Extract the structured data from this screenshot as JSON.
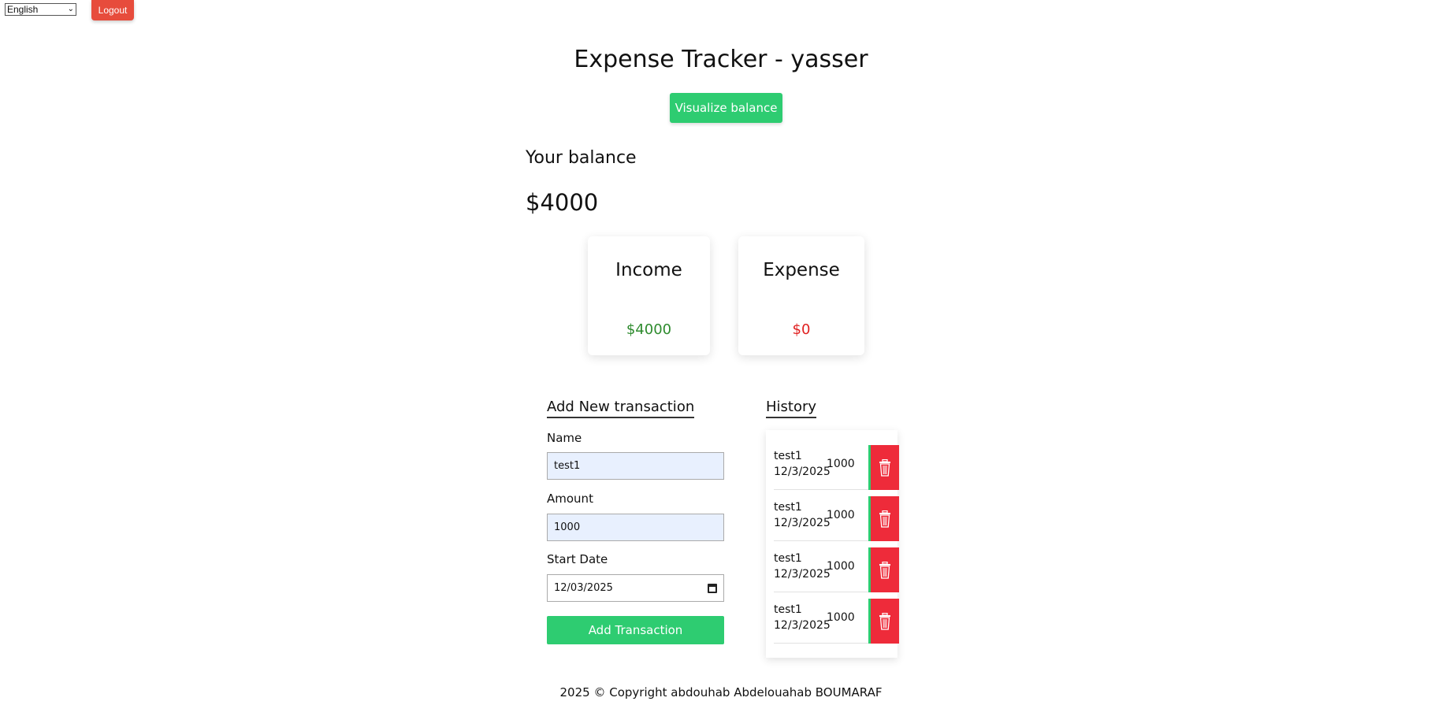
{
  "header": {
    "language_selected": "English",
    "logout_label": "Logout"
  },
  "title": "Expense Tracker - yasser",
  "visualize_label": "Visualize balance",
  "balance": {
    "label": "Your balance",
    "value": "$4000"
  },
  "income": {
    "title": "Income",
    "amount": "$4000"
  },
  "expense": {
    "title": "Expense",
    "amount": "$0"
  },
  "form": {
    "heading": "Add New transaction",
    "name_label": "Name",
    "name_value": "test1",
    "amount_label": "Amount",
    "amount_value": "1000",
    "date_label": "Start Date",
    "date_value": "12/03/2025",
    "submit_label": "Add Transaction"
  },
  "history": {
    "heading": "History",
    "items": [
      {
        "name": "test1",
        "date": "12/3/2025",
        "amount": "1000"
      },
      {
        "name": "test1",
        "date": "12/3/2025",
        "amount": "1000"
      },
      {
        "name": "test1",
        "date": "12/3/2025",
        "amount": "1000"
      },
      {
        "name": "test1",
        "date": "12/3/2025",
        "amount": "1000"
      }
    ]
  },
  "footer": "2025 © Copyright abdouhab Abdelouahab BOUMARAF",
  "colors": {
    "accent_green": "#2ecc71",
    "logout_red": "#e74c3c",
    "delete_red": "#ee2b3a",
    "income_green": "#2e8b2e",
    "expense_red": "#e02020"
  }
}
